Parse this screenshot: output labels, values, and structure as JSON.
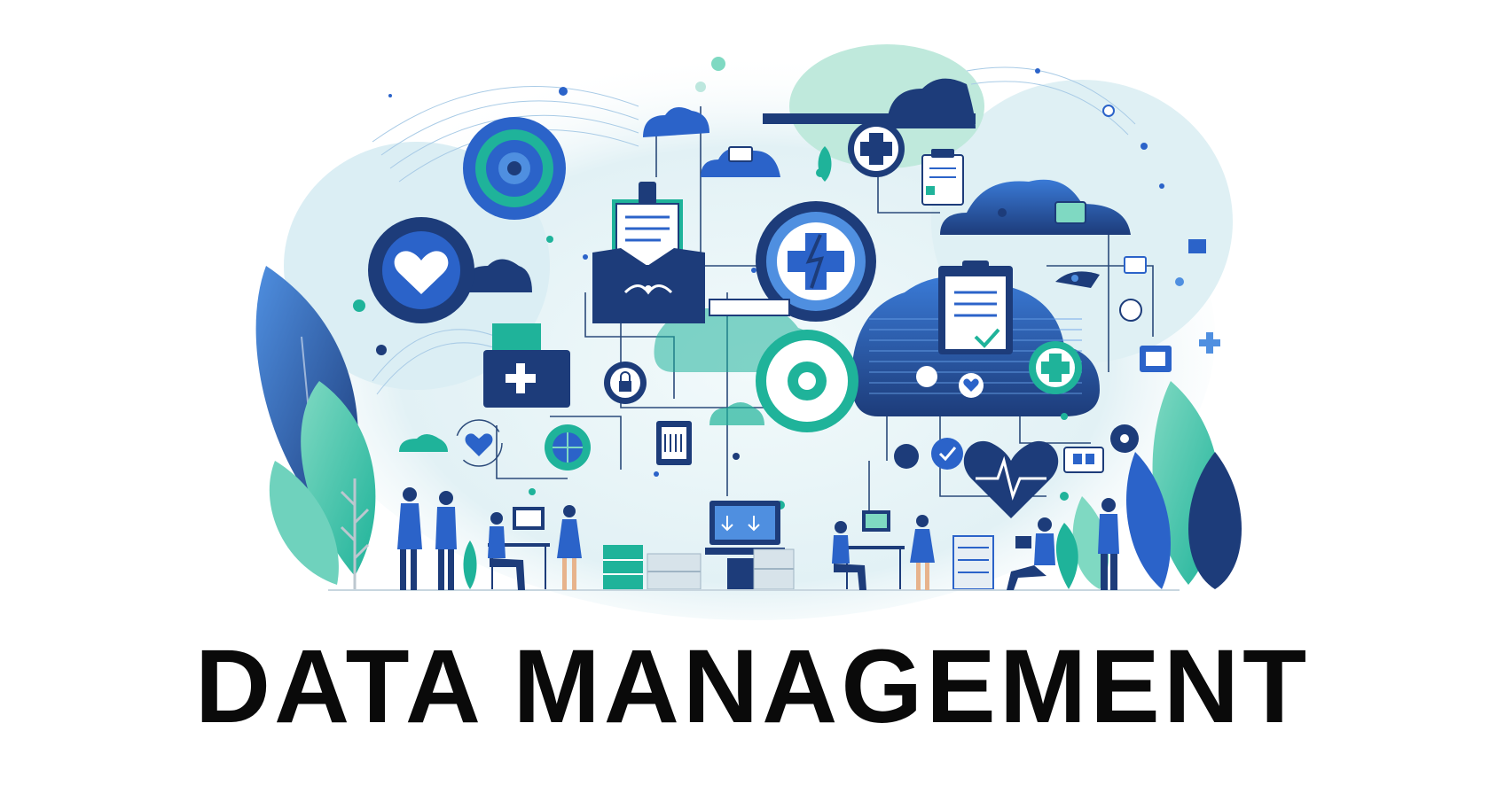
{
  "headline": "DATA MANAGEMENT",
  "palette": {
    "navy": "#1d3c7a",
    "blue": "#2b63c9",
    "sky": "#4f8fe0",
    "teal": "#1fb39a",
    "mint": "#7fd9c2",
    "pale": "#e3f1f5",
    "white": "#ffffff"
  },
  "icons": [
    "heart-bubble-icon",
    "target-icon",
    "folder-document-icon",
    "first-aid-kit-icon",
    "medical-cross-icon",
    "lightning-cross-icon",
    "clipboard-check-icon",
    "server-cloud-icon",
    "heartbeat-icon",
    "lock-icon",
    "checkmark-icon",
    "monitor-icon",
    "filing-cabinet-icon"
  ]
}
